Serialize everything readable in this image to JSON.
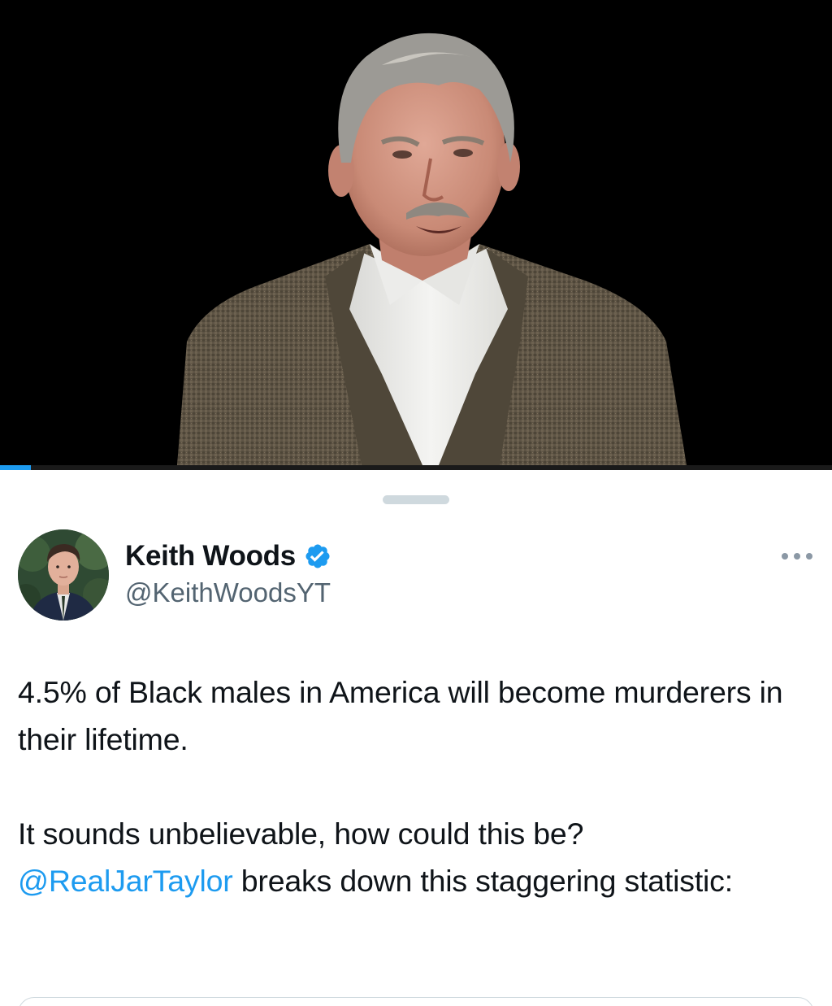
{
  "video": {
    "progress_fraction": 0.037,
    "accent_color": "#1d9bf0"
  },
  "tweet": {
    "author": {
      "name": "Keith Woods",
      "handle": "@KeithWoodsYT",
      "verified": true
    },
    "text": {
      "paragraph_1": "4.5% of Black males in America will become murderers in their lifetime.",
      "paragraph_2_line_1": "It sounds unbelievable, how could this be?",
      "mention": "@RealJarTaylor",
      "paragraph_2_rest": " breaks down this staggering statistic:"
    }
  },
  "icons": {
    "verified": "verified-badge-icon",
    "more": "more-options-icon"
  },
  "colors": {
    "link": "#1d9bf0",
    "text": "#0f1419",
    "secondary_text": "#536471"
  }
}
